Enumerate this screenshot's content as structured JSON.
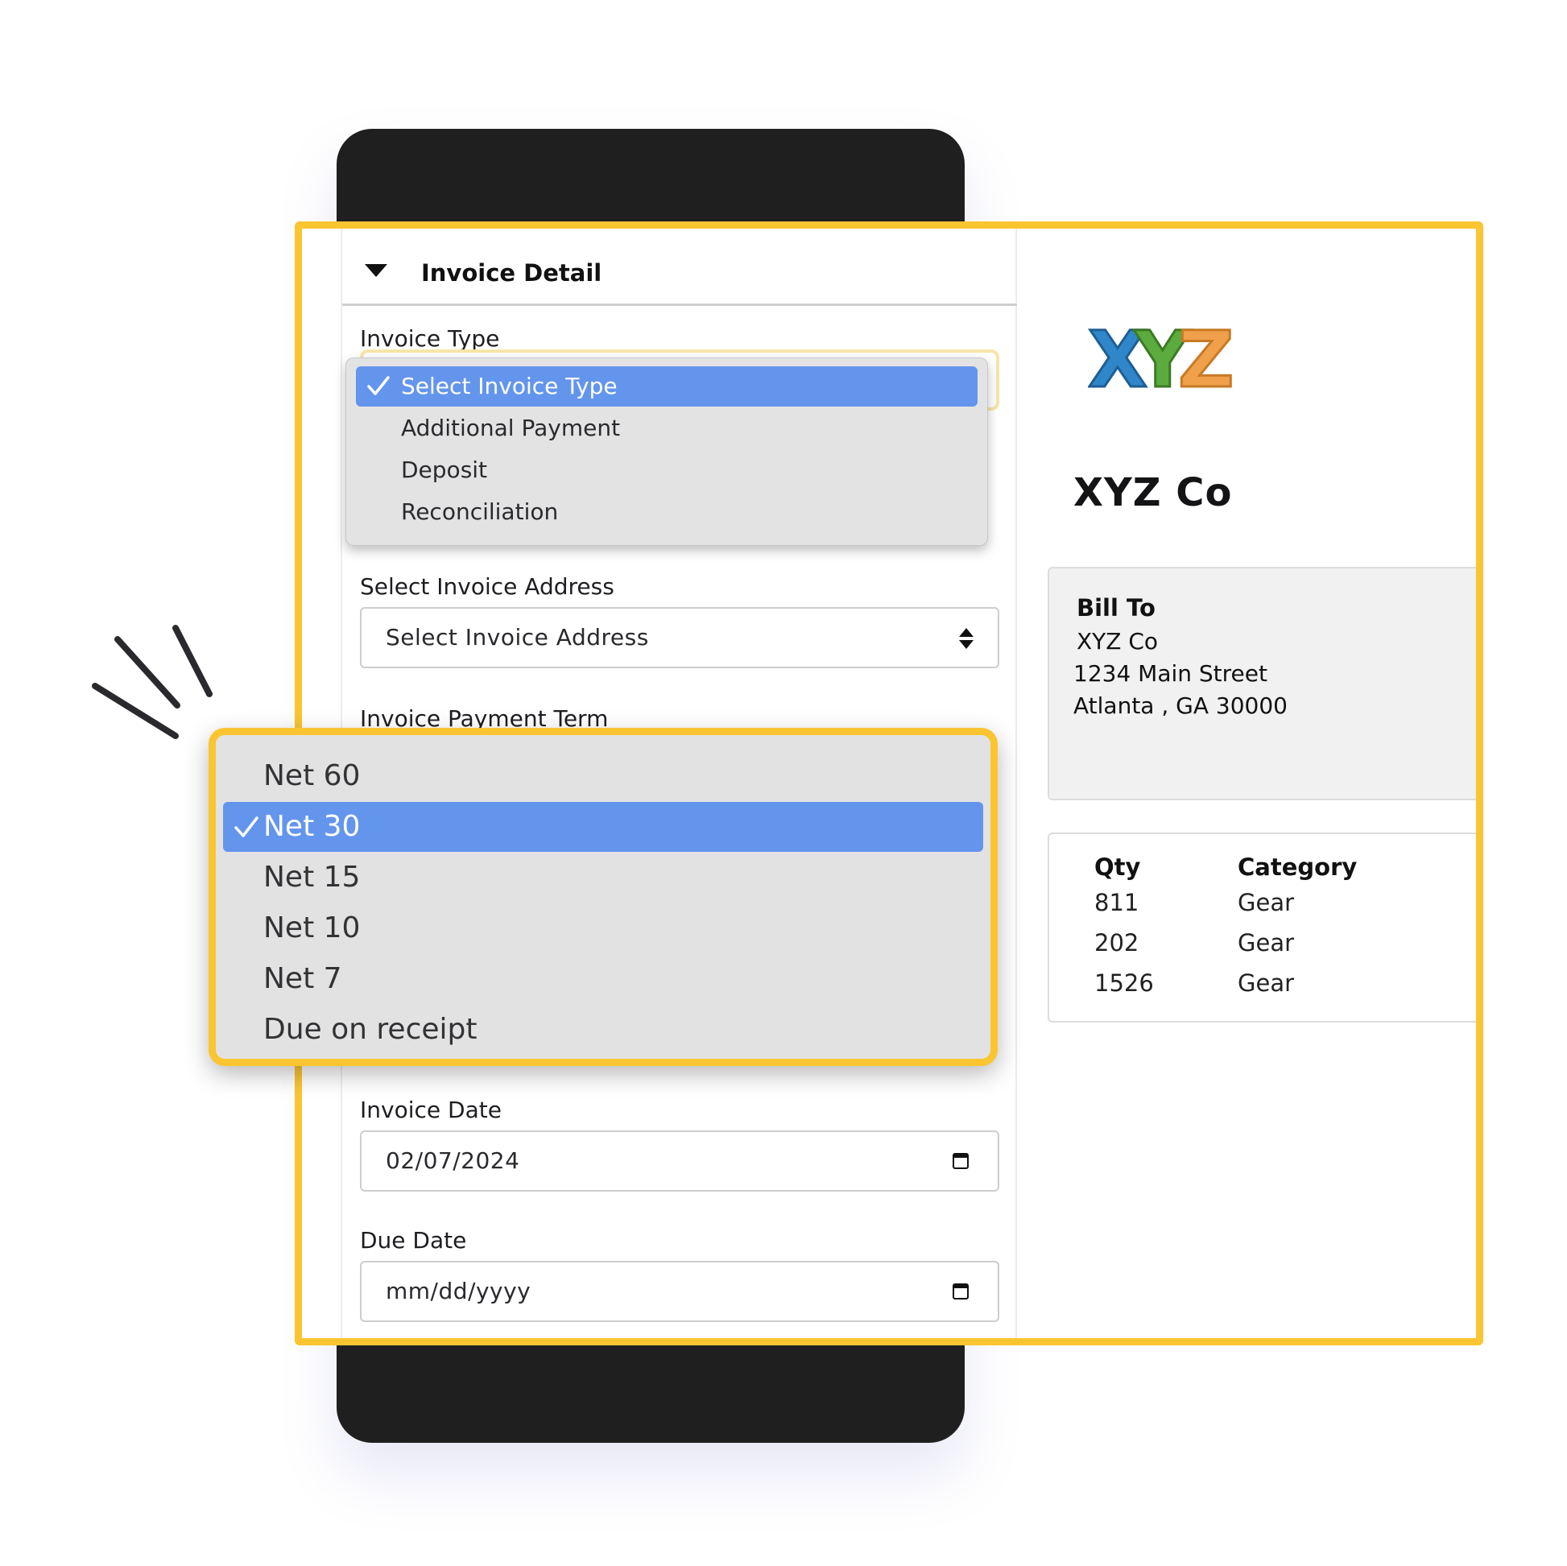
{
  "section": {
    "title": "Invoice Detail"
  },
  "fields": {
    "invoice_type_label": "Invoice Type",
    "invoice_address_label": "Select Invoice Address",
    "invoice_address_value": "Select Invoice Address",
    "payment_term_label": "Invoice Payment Term",
    "invoice_date_label": "Invoice Date",
    "invoice_date_value": "02/07/2024",
    "due_date_label": "Due Date",
    "due_date_placeholder": "mm/dd/yyyy"
  },
  "invoice_type_menu": {
    "selected": "Select Invoice Type",
    "options": [
      "Select Invoice Type",
      "Additional Payment",
      "Deposit",
      "Reconciliation"
    ]
  },
  "payment_term_menu": {
    "selected": "Net 30",
    "options": [
      "Net 60",
      "Net 30",
      "Net 15",
      "Net 10",
      "Net 7",
      "Due on receipt"
    ]
  },
  "company": {
    "logo_text": "XYZ",
    "logo_colors": [
      "#2f86c9",
      "#5cab3f",
      "#f0a04b"
    ],
    "name": "XYZ Co"
  },
  "bill_to": {
    "title": "Bill To",
    "lines": [
      "XYZ Co",
      "1234 Main Street",
      "Atlanta , GA 30000"
    ]
  },
  "items": {
    "headers": [
      "Qty",
      "Category"
    ],
    "rows": [
      [
        "811",
        "Gear"
      ],
      [
        "202",
        "Gear"
      ],
      [
        "1526",
        "Gear"
      ]
    ]
  },
  "colors": {
    "highlight": "#fbc531",
    "selected": "#6495ed",
    "backdrop": "#1f1f20"
  }
}
